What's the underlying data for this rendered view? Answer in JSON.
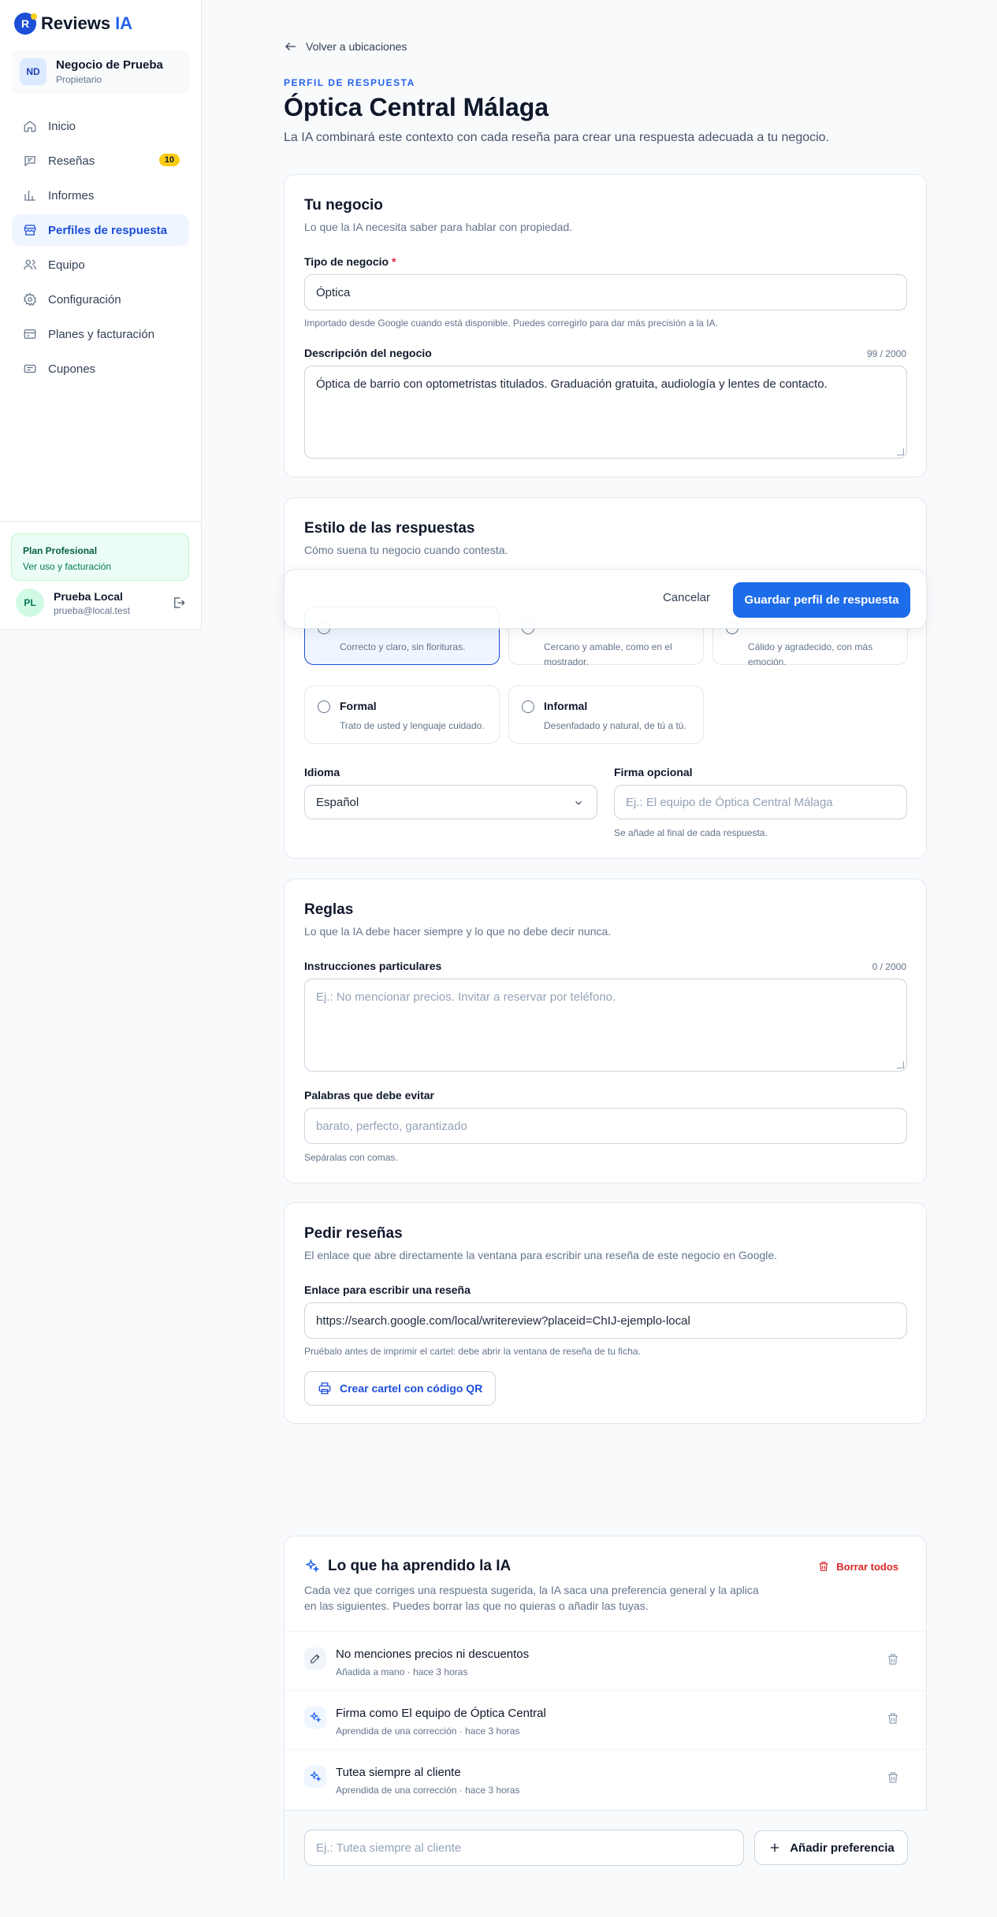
{
  "brand": {
    "name": "Reviews",
    "accent": "IA",
    "logo_letter": "R"
  },
  "business": {
    "initials": "ND",
    "name": "Negocio de Prueba",
    "role": "Propietario"
  },
  "nav": [
    {
      "label": "Inicio",
      "icon": "home-icon"
    },
    {
      "label": "Reseñas",
      "icon": "message-icon",
      "badge": "10"
    },
    {
      "label": "Informes",
      "icon": "chart-icon"
    },
    {
      "label": "Perfiles de respuesta",
      "icon": "store-icon",
      "active": true
    },
    {
      "label": "Equipo",
      "icon": "users-icon"
    },
    {
      "label": "Configuración",
      "icon": "gear-icon"
    },
    {
      "label": "Planes y facturación",
      "icon": "card-icon"
    },
    {
      "label": "Cupones",
      "icon": "ticket-icon"
    }
  ],
  "plan": {
    "title": "Plan Profesional",
    "subtitle": "Ver uso y facturación"
  },
  "user": {
    "initials": "PL",
    "name": "Prueba Local",
    "email": "prueba@local.test"
  },
  "header": {
    "back": "Volver a ubicaciones",
    "eyebrow": "PERFIL DE RESPUESTA",
    "title": "Óptica Central Málaga",
    "description": "La IA combinará este contexto con cada reseña para crear una respuesta adecuada a tu negocio."
  },
  "business_card": {
    "title": "Tu negocio",
    "subtitle": "Lo que la IA necesita saber para hablar con propiedad.",
    "type_label": "Tipo de negocio",
    "type_required": "*",
    "type_value": "Óptica",
    "type_help": "Importado desde Google cuando está disponible. Puedes corregirlo para dar más precisión a la IA.",
    "desc_label": "Descripción del negocio",
    "desc_counter": "99 / 2000",
    "desc_value": "Óptica de barrio con optometristas titulados. Graduación gratuita, audiología y lentes de contacto."
  },
  "style_card": {
    "title": "Estilo de las respuestas",
    "subtitle": "Cómo suena tu negocio cuando contesta.",
    "options": [
      {
        "title": "",
        "desc": "Correcto y claro, sin florituras.",
        "selected": true
      },
      {
        "title": "",
        "desc": "Cercano y amable, como en el mostrador."
      },
      {
        "title": "",
        "desc": "Cálido y agradecido, con más emoción."
      },
      {
        "title": "Formal",
        "desc": "Trato de usted y lenguaje cuidado."
      },
      {
        "title": "Informal",
        "desc": "Desenfadado y natural, de tú a tú."
      }
    ],
    "language_label": "Idioma",
    "language_value": "Español",
    "signature_label": "Firma opcional",
    "signature_placeholder": "Ej.: El equipo de Óptica Central Málaga",
    "signature_help": "Se añade al final de cada respuesta."
  },
  "actions": {
    "cancel": "Cancelar",
    "save": "Guardar perfil de respuesta"
  },
  "rules_card": {
    "title": "Reglas",
    "subtitle": "Lo que la IA debe hacer siempre y lo que no debe decir nunca.",
    "instructions_label": "Instrucciones particulares",
    "instructions_counter": "0 / 2000",
    "instructions_placeholder": "Ej.: No mencionar precios. Invitar a reservar por teléfono.",
    "avoid_label": "Palabras que debe evitar",
    "avoid_placeholder": "barato, perfecto, garantizado",
    "avoid_help": "Sepáralas con comas."
  },
  "reviews_card": {
    "title": "Pedir reseñas",
    "subtitle": "El enlace que abre directamente la ventana para escribir una reseña de este negocio en Google.",
    "link_label": "Enlace para escribir una reseña",
    "link_value": "https://search.google.com/local/writereview?placeid=ChIJ-ejemplo-local",
    "link_help": "Pruébalo antes de imprimir el cartel: debe abrir la ventana de reseña de tu ficha.",
    "qr_button": "Crear cartel con código QR"
  },
  "learned_card": {
    "title": "Lo que ha aprendido la IA",
    "clear_all": "Borrar todos",
    "description": "Cada vez que corriges una respuesta sugerida, la IA saca una preferencia general y la aplica en las siguientes. Puedes borrar las que no quieras o añadir las tuyas.",
    "items": [
      {
        "text": "No menciones precios ni descuentos",
        "meta": "Añadida a mano · hace 3 horas",
        "icon": "pencil-icon"
      },
      {
        "text": "Firma como El equipo de Óptica Central",
        "meta": "Aprendida de una corrección · hace 3 horas",
        "icon": "sparkle-icon"
      },
      {
        "text": "Tutea siempre al cliente",
        "meta": "Aprendida de una corrección · hace 3 horas",
        "icon": "sparkle-icon"
      }
    ],
    "add_placeholder": "Ej.: Tutea siempre al cliente",
    "add_button": "Añadir preferencia"
  },
  "colors": {
    "primary": "#1d6cea",
    "accent_badge": "#facc15",
    "danger": "#dc2626",
    "plan_bg": "#ecfdf5"
  }
}
